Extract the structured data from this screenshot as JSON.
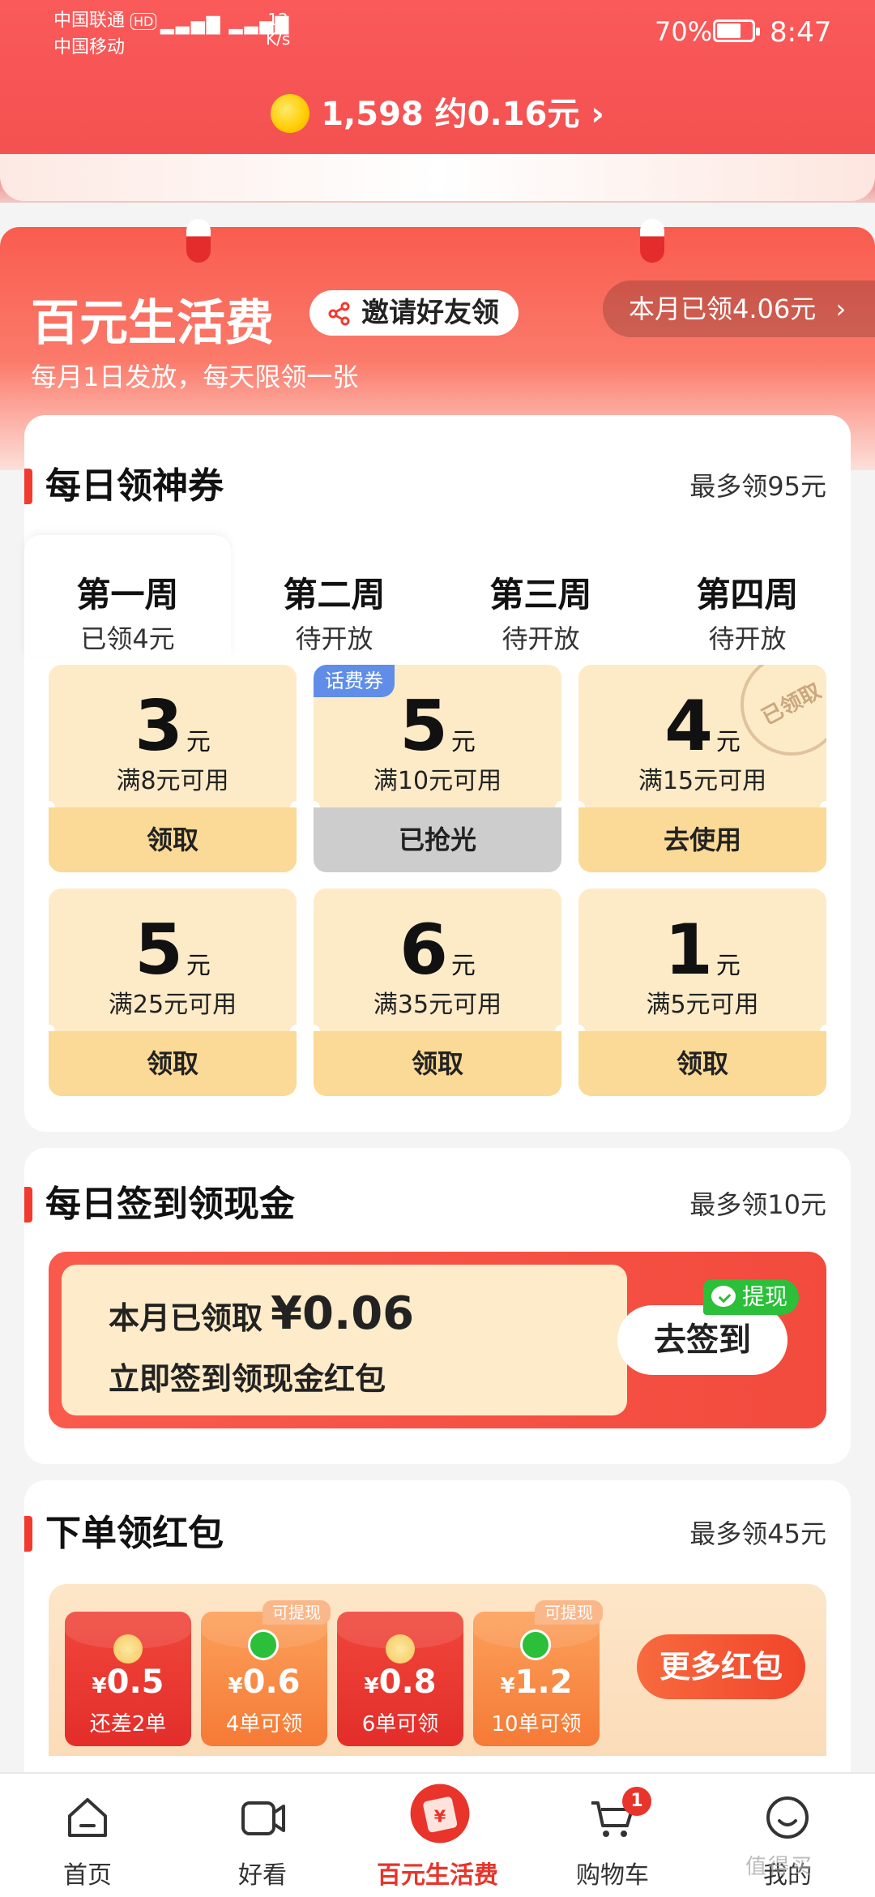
{
  "status_bar": {
    "carrier1": "中国联通",
    "hd": "HD",
    "carrier2": "中国移动",
    "net_speed": "12",
    "net_unit": "K/s",
    "battery": "70%",
    "battery_level": 0.7,
    "time": "8:47"
  },
  "header": {
    "coins": "1,598",
    "coin_value": "约0.16元",
    "chevron": "›"
  },
  "hero": {
    "title": "百元生活费",
    "invite_label": "邀请好友领",
    "month_claimed": "本月已领4.06元",
    "subtitle": "每月1日发放，每天限领一张"
  },
  "daily_coupons": {
    "title": "每日领神券",
    "max": "最多领95元",
    "weeks": [
      {
        "name": "第一周",
        "state": "已领4元"
      },
      {
        "name": "第二周",
        "state": "待开放"
      },
      {
        "name": "第三周",
        "state": "待开放"
      },
      {
        "name": "第四周",
        "state": "待开放"
      }
    ],
    "coupons": [
      {
        "amount": "3",
        "unit": "元",
        "cond": "满8元可用",
        "btn": "领取"
      },
      {
        "amount": "5",
        "unit": "元",
        "cond": "满10元可用",
        "btn": "已抢光",
        "tag": "话费券"
      },
      {
        "amount": "4",
        "unit": "元",
        "cond": "满15元可用",
        "btn": "去使用",
        "stamp": "已领取"
      },
      {
        "amount": "5",
        "unit": "元",
        "cond": "满25元可用",
        "btn": "领取"
      },
      {
        "amount": "6",
        "unit": "元",
        "cond": "满35元可用",
        "btn": "领取"
      },
      {
        "amount": "1",
        "unit": "元",
        "cond": "满5元可用",
        "btn": "领取"
      }
    ]
  },
  "sign_in": {
    "title": "每日签到领现金",
    "max": "最多领10元",
    "claimed_label": "本月已领取",
    "claimed_amount": "¥0.06",
    "desc": "立即签到领现金红包",
    "btn": "去签到",
    "withdraw": "提现"
  },
  "order_packets": {
    "title": "下单领红包",
    "max": "最多领45元",
    "packets": [
      {
        "currency": "¥",
        "value": "0.5",
        "req": "还差2单"
      },
      {
        "currency": "¥",
        "value": "0.6",
        "req": "4单可领",
        "tag": "可提现"
      },
      {
        "currency": "¥",
        "value": "0.8",
        "req": "6单可领"
      },
      {
        "currency": "¥",
        "value": "1.2",
        "req": "10单可领",
        "tag": "可提现"
      }
    ],
    "more_btn": "更多红包"
  },
  "bottom_nav": {
    "items": [
      {
        "label": "首页"
      },
      {
        "label": "好看"
      },
      {
        "label": "百元生活费"
      },
      {
        "label": "购物车",
        "badge": "1"
      },
      {
        "label": "我的"
      }
    ]
  },
  "watermark": "值得买",
  "colors": {
    "primary_red": "#f45151",
    "accent_red": "#e8342a",
    "coupon_bg": "#fdebc8",
    "coupon_btn": "#fbd996",
    "green": "#2bbf3a"
  }
}
